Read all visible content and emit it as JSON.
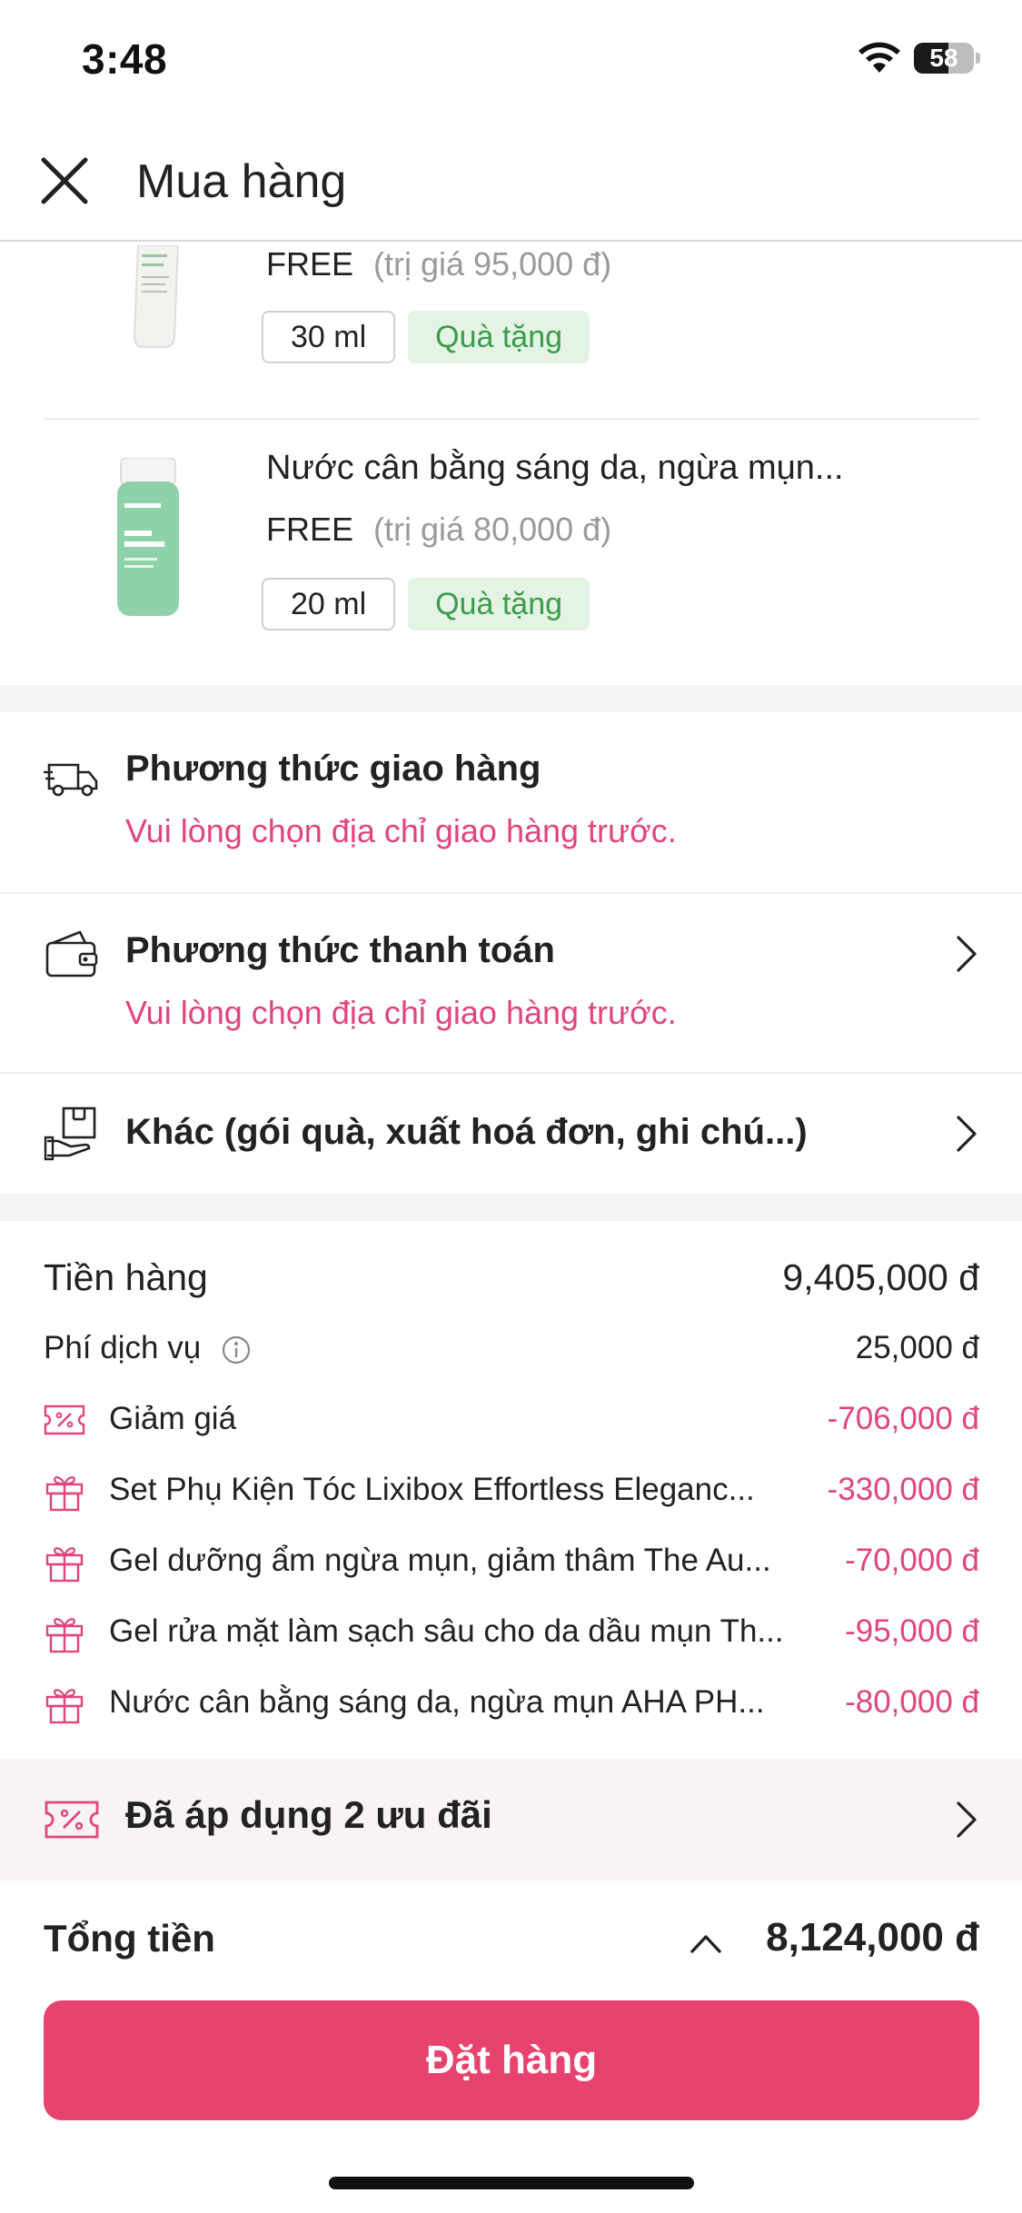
{
  "status_bar": {
    "time": "3:48",
    "battery": "58",
    "battery_level": 0.58
  },
  "header": {
    "title": "Mua hàng",
    "close_icon": "close-icon"
  },
  "gift_items": [
    {
      "name": "",
      "free_label": "FREE",
      "worth": "(trị giá 95,000 đ)",
      "size": "30 ml",
      "tag": "Quà tặng",
      "thumb_color": "#f2f2ef"
    },
    {
      "name": "Nước cân bằng sáng da, ngừa mụn...",
      "free_label": "FREE",
      "worth": "(trị giá 80,000 đ)",
      "size": "20 ml",
      "tag": "Quà tặng",
      "thumb_color": "#8fd1a9"
    }
  ],
  "shipping": {
    "title": "Phương thức giao hàng",
    "message": "Vui lòng chọn địa chỉ giao hàng trước.",
    "icon": "truck-icon"
  },
  "payment": {
    "title": "Phương thức thanh toán",
    "message": "Vui lòng chọn địa chỉ giao hàng trước.",
    "icon": "wallet-icon"
  },
  "other": {
    "title": "Khác (gói quà, xuất hoá đơn, ghi chú...)",
    "icon": "gift-box-hand-icon"
  },
  "summary": {
    "subtotal_label": "Tiền hàng",
    "subtotal_value": "9,405,000 đ",
    "service_fee_label": "Phí dịch vụ",
    "service_fee_value": "25,000 đ",
    "discount_label": "Giảm giá",
    "discount_value": "-706,000 đ",
    "gift_lines": [
      {
        "label": "Set Phụ Kiện Tóc Lixibox Effortless Eleganc...",
        "value": "-330,000 đ"
      },
      {
        "label": "Gel dưỡng ẩm ngừa mụn, giảm thâm The Au...",
        "value": "-70,000 đ"
      },
      {
        "label": "Gel rửa mặt làm sạch sâu cho da dầu mụn Th...",
        "value": "-95,000 đ"
      },
      {
        "label": "Nước cân bằng sáng da, ngừa mụn AHA PH...",
        "value": "-80,000 đ"
      }
    ]
  },
  "offers": {
    "text": "Đã áp dụng 2 ưu đãi",
    "icon": "coupon-icon"
  },
  "total": {
    "label": "Tổng tiền",
    "value": "8,124,000 đ"
  },
  "order_button": {
    "label": "Đặt hàng"
  },
  "colors": {
    "accent": "#e8436f",
    "warning_text": "#e0457b",
    "gift_tag_bg": "#e4f3e4",
    "gift_tag_text": "#3a9c4a"
  }
}
